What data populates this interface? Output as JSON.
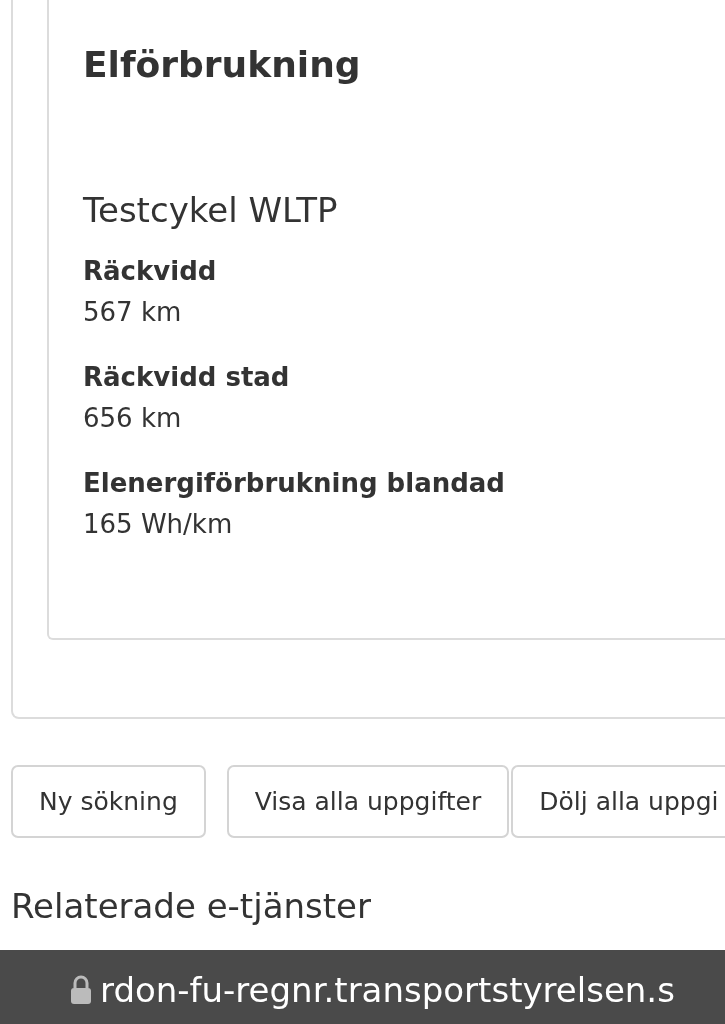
{
  "section": {
    "title": "Elförbrukning",
    "subtitle": "Testcykel WLTP",
    "items": [
      {
        "label": "Räckvidd",
        "value": "567 km"
      },
      {
        "label": "Räckvidd stad",
        "value": "656 km"
      },
      {
        "label": "Elenergiförbrukning blandad",
        "value": "165 Wh/km"
      }
    ]
  },
  "buttons": [
    {
      "label": "Ny sökning"
    },
    {
      "label": "Visa alla uppgifter"
    },
    {
      "label": "Dölj alla uppgi"
    }
  ],
  "related": {
    "title": "Relaterade e-tjänster"
  },
  "url_bar": {
    "url": "rdon-fu-regnr.transportstyrelsen.s"
  }
}
